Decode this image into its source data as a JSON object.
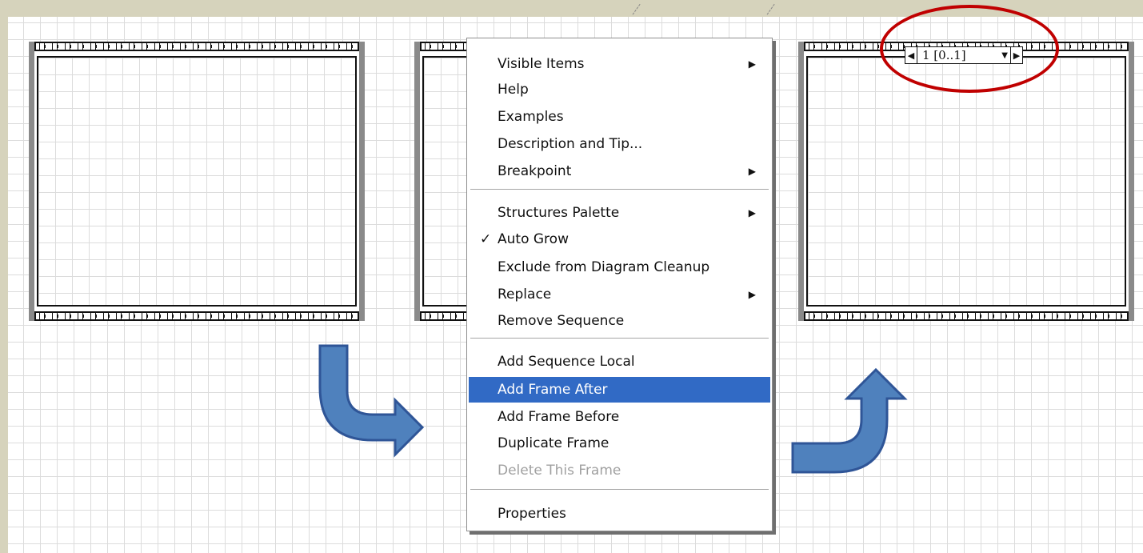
{
  "sequence_frame_selector": {
    "left_arrow_icon": "triangle-left",
    "text": "1 [0..1]",
    "dropdown_icon": "triangle-down",
    "right_arrow_icon": "triangle-right"
  },
  "context_menu": {
    "items": [
      {
        "label": "Visible Items",
        "submenu": true
      },
      {
        "label": "Help"
      },
      {
        "label": "Examples"
      },
      {
        "label": "Description and Tip..."
      },
      {
        "label": "Breakpoint",
        "submenu": true
      },
      {
        "label": "Structures Palette",
        "submenu": true
      },
      {
        "label": "Auto Grow",
        "checked": true
      },
      {
        "label": "Exclude from Diagram Cleanup"
      },
      {
        "label": "Replace",
        "submenu": true
      },
      {
        "label": "Remove Sequence"
      },
      {
        "label": "Add Sequence Local"
      },
      {
        "label": "Add Frame After",
        "highlighted": true
      },
      {
        "label": "Add Frame Before"
      },
      {
        "label": "Duplicate Frame"
      },
      {
        "label": "Delete This Frame",
        "disabled": true
      },
      {
        "label": "Properties"
      }
    ],
    "check_glyph": "✓",
    "submenu_glyph": "▶"
  },
  "colors": {
    "background": "#d6d3bc",
    "grid": "#dcdcdc",
    "highlight": "#316ac5",
    "annotation_ellipse": "#c00000",
    "flow_arrow": "#4f81bd"
  }
}
